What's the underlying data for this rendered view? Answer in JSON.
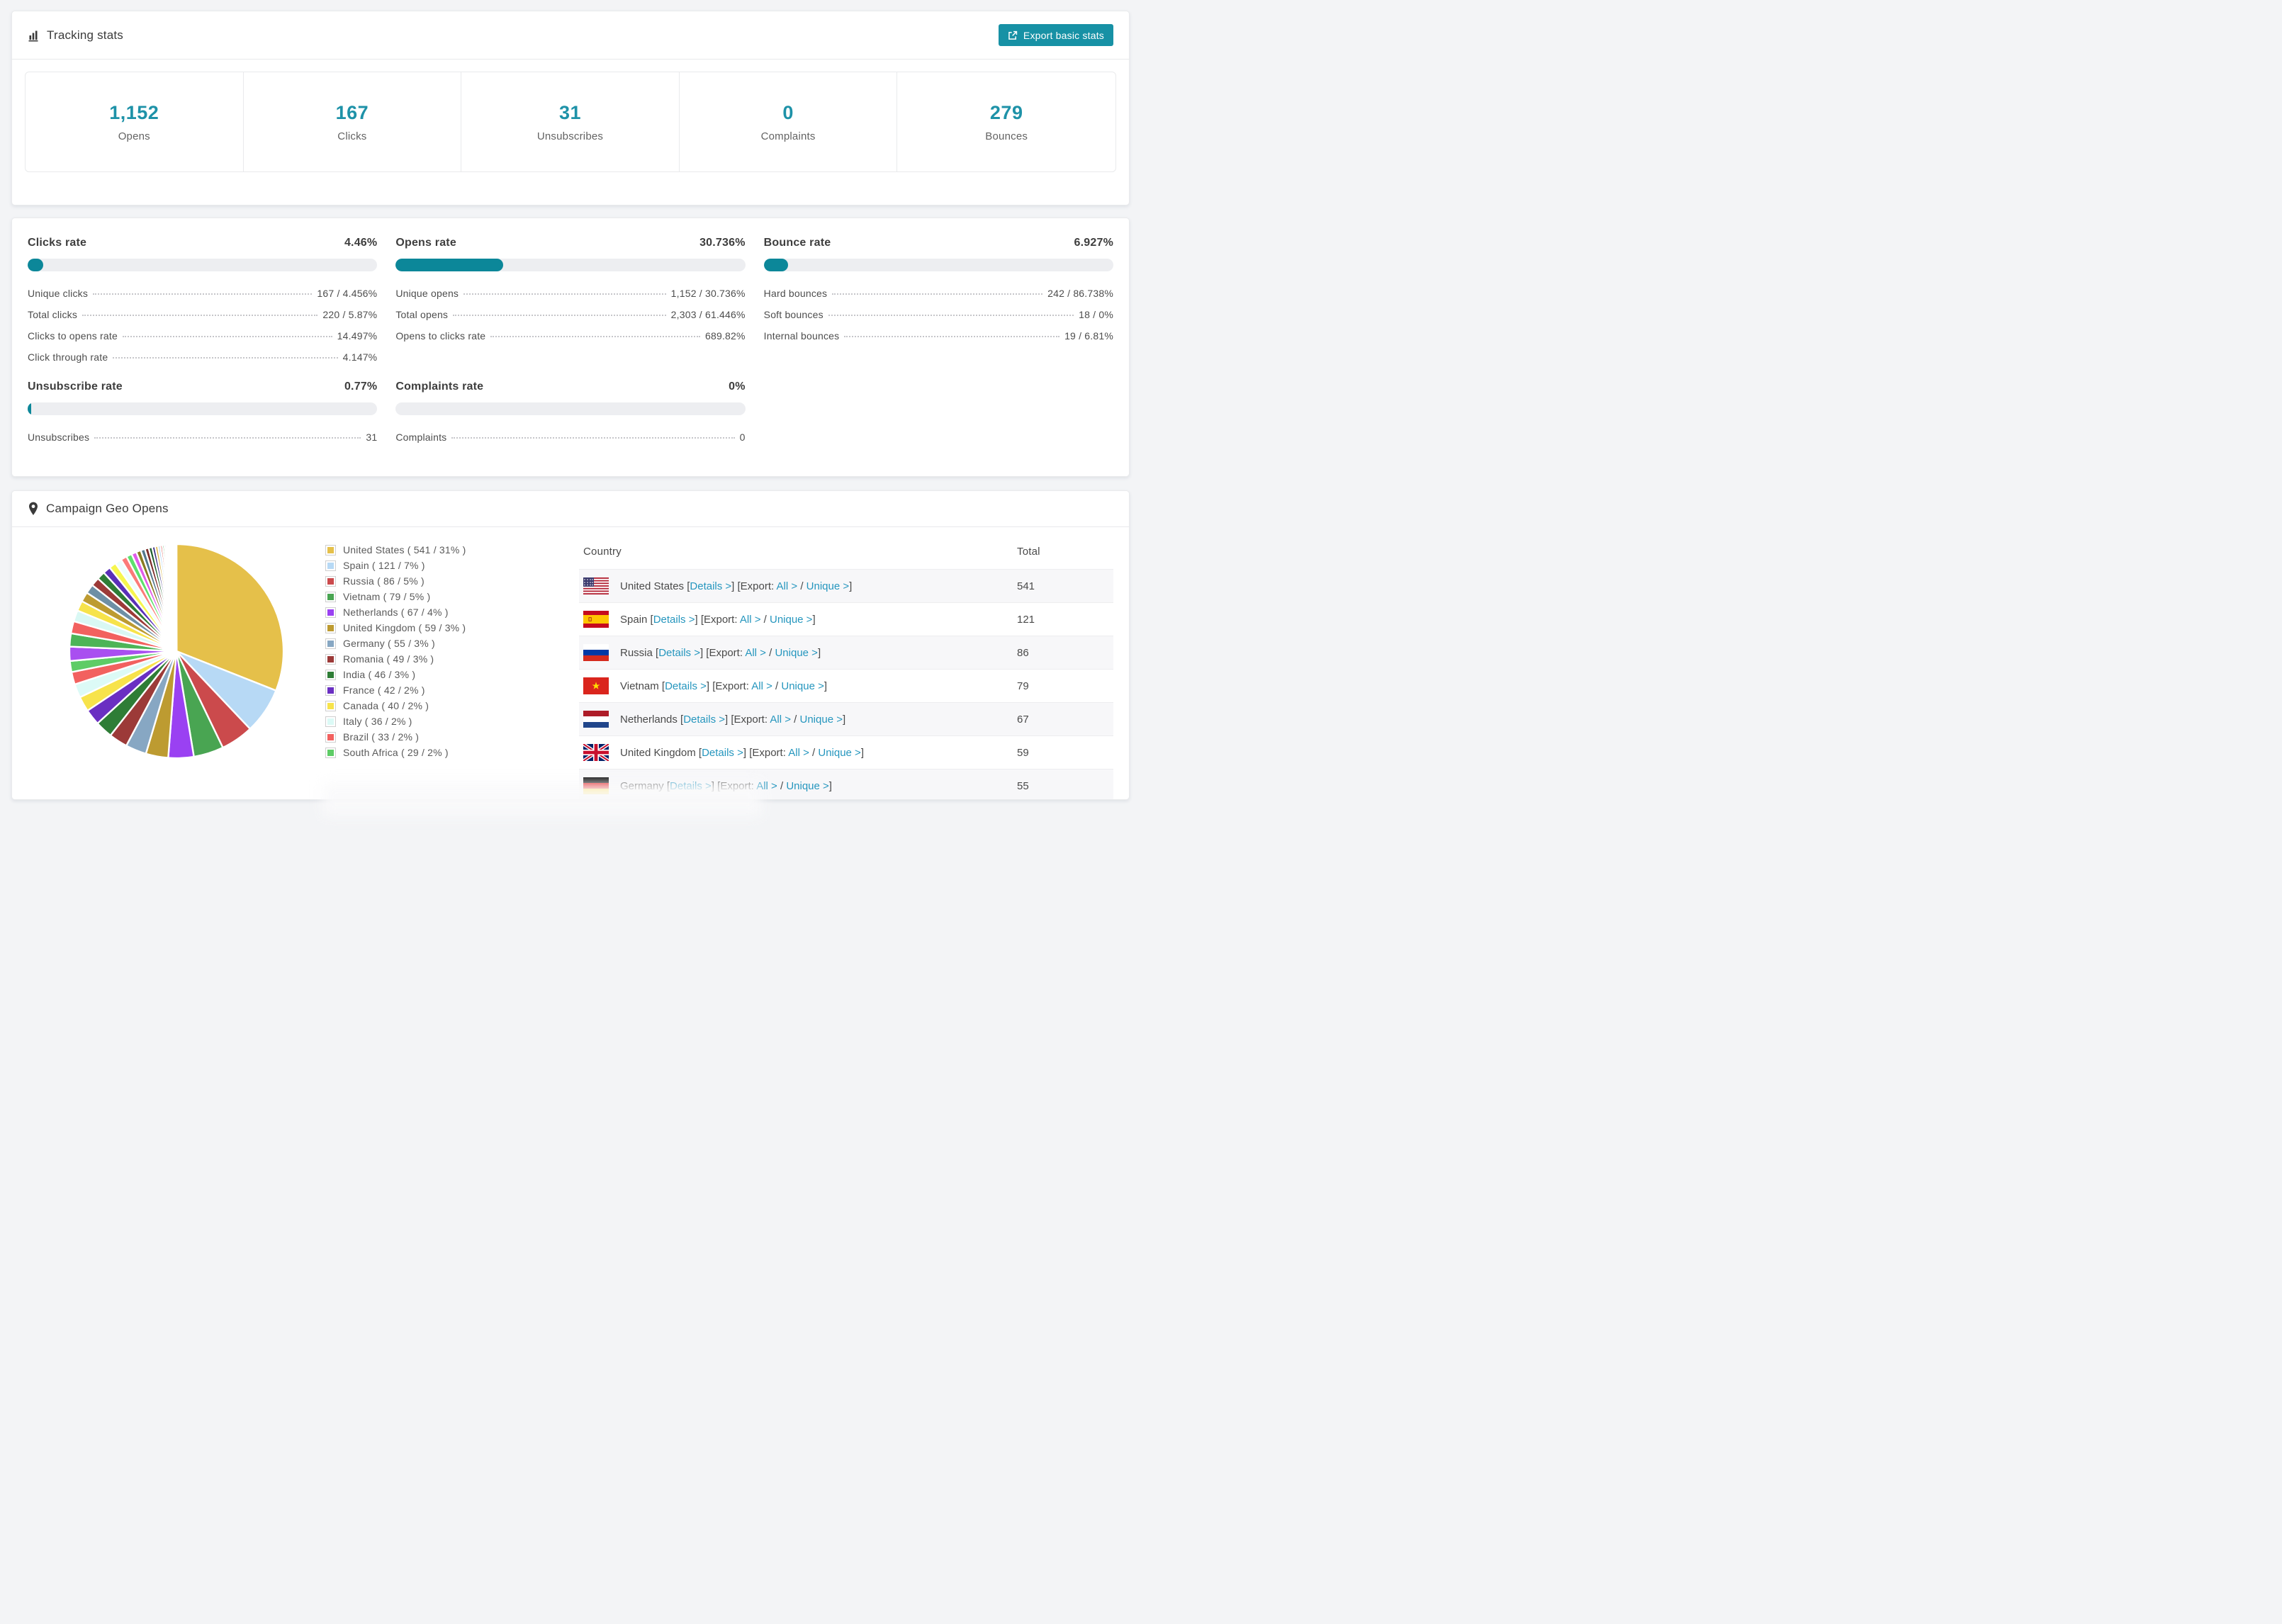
{
  "icons": {
    "tracking_header": "bar-chart-icon",
    "geo_header": "map-pin-icon",
    "export_button": "export-icon"
  },
  "colors": {
    "accent_button": "#1791a5",
    "stat_number": "#1e92a8",
    "bar_fill": "#0c8799",
    "bar_track": "#edeef1",
    "link": "#2596be",
    "row_stripe": "#f7f7f9"
  },
  "tracking": {
    "title": "Tracking stats",
    "export_label": "Export basic stats",
    "summary": [
      {
        "value": "1,152",
        "label": "Opens"
      },
      {
        "value": "167",
        "label": "Clicks"
      },
      {
        "value": "31",
        "label": "Unsubscribes"
      },
      {
        "value": "0",
        "label": "Complaints"
      },
      {
        "value": "279",
        "label": "Bounces"
      }
    ]
  },
  "rates": [
    {
      "id": "clicks-rate",
      "title": "Clicks rate",
      "pct": "4.46%",
      "bar": 4.46,
      "rows": [
        [
          "Unique clicks",
          "167 / 4.456%"
        ],
        [
          "Total clicks",
          "220 / 5.87%"
        ],
        [
          "Clicks to opens rate",
          "14.497%"
        ],
        [
          "Click through rate",
          "4.147%"
        ]
      ]
    },
    {
      "id": "opens-rate",
      "title": "Opens rate",
      "pct": "30.736%",
      "bar": 30.736,
      "rows": [
        [
          "Unique opens",
          "1,152 / 30.736%"
        ],
        [
          "Total opens",
          "2,303 / 61.446%"
        ],
        [
          "Opens to clicks rate",
          "689.82%"
        ]
      ]
    },
    {
      "id": "bounce-rate",
      "title": "Bounce rate",
      "pct": "6.927%",
      "bar": 6.927,
      "rows": [
        [
          "Hard bounces",
          "242 / 86.738%"
        ],
        [
          "Soft bounces",
          "18 / 0%"
        ],
        [
          "Internal bounces",
          "19 / 6.81%"
        ]
      ]
    },
    {
      "id": "unsubscribe-rate",
      "title": "Unsubscribe rate",
      "pct": "0.77%",
      "bar": 0.77,
      "rows": [
        [
          "Unsubscribes",
          "31"
        ]
      ]
    },
    {
      "id": "complaints-rate",
      "title": "Complaints rate",
      "pct": "0%",
      "bar": 0,
      "rows": [
        [
          "Complaints",
          "0"
        ]
      ]
    }
  ],
  "geo": {
    "title": "Campaign Geo Opens",
    "chart_data": {
      "type": "pie",
      "start_angle_deg": -90,
      "direction": "clockwise",
      "legend_position": "right",
      "slices": [
        {
          "label": "United States",
          "value": 541,
          "pct": "31%",
          "color": "#e5c04a"
        },
        {
          "label": "Spain",
          "value": 121,
          "pct": "7%",
          "color": "#b7d9f5"
        },
        {
          "label": "Russia",
          "value": 86,
          "pct": "5%",
          "color": "#cb4a4c"
        },
        {
          "label": "Vietnam",
          "value": 79,
          "pct": "5%",
          "color": "#49a552"
        },
        {
          "label": "Netherlands",
          "value": 67,
          "pct": "4%",
          "color": "#9a41f2"
        },
        {
          "label": "United Kingdom",
          "value": 59,
          "pct": "3%",
          "color": "#bd9b31"
        },
        {
          "label": "Germany",
          "value": 55,
          "pct": "3%",
          "color": "#87a7c3"
        },
        {
          "label": "Romania",
          "value": 49,
          "pct": "3%",
          "color": "#9c3a38"
        },
        {
          "label": "India",
          "value": 46,
          "pct": "3%",
          "color": "#2e7d36"
        },
        {
          "label": "France",
          "value": 42,
          "pct": "2%",
          "color": "#6a2fc2"
        },
        {
          "label": "Canada",
          "value": 40,
          "pct": "2%",
          "color": "#f7e34b"
        },
        {
          "label": "Italy",
          "value": 36,
          "pct": "2%",
          "color": "#dcfaf6"
        },
        {
          "label": "Brazil",
          "value": 33,
          "pct": "2%",
          "color": "#f2615f"
        },
        {
          "label": "South Africa",
          "value": 29,
          "pct": "2%",
          "color": "#5ecc66"
        }
      ],
      "others_total": 462,
      "others_weights": [
        14,
        13,
        12,
        11,
        10,
        9.5,
        9,
        8.5,
        8,
        7.5,
        7,
        6.5,
        6,
        5.5,
        5,
        4.6,
        4.2,
        3.8,
        3.4,
        3,
        2.7,
        2.4,
        2.1,
        1.9,
        1.7,
        1.5,
        1.3,
        1.1,
        1,
        0.9,
        0.8,
        0.7,
        0.6,
        0.5,
        0.42,
        0.35,
        0.28,
        0.22,
        0.17,
        0.12,
        0.08,
        0.05
      ],
      "others_palette": [
        "#a94ff0",
        "#4db457",
        "#f2615f",
        "#d9f8f4",
        "#f7e34b",
        "#bd9b31",
        "#6e8fa5",
        "#9c3a38",
        "#2e7d36",
        "#5a2fb8",
        "#f6f64e",
        "#ecfffd",
        "#fb7b78",
        "#5ee06d",
        "#e05ce9",
        "#8a7a20",
        "#54788c",
        "#7c2d2a",
        "#1f5f2c",
        "#3c2f85",
        "#d6ab32",
        "#a9cef2",
        "#d94a47",
        "#42a44f",
        "#8f3be0"
      ]
    },
    "legend_format": {
      "open": "( ",
      "sep": " / ",
      "close": " )"
    },
    "table": {
      "headers": [
        "Country",
        "Total"
      ],
      "fmt": {
        "lb": "[",
        "rb": "]",
        "details": "Details >",
        "export": "Export:",
        "all": "All >",
        "sep": "/",
        "unique": "Unique >"
      },
      "rows": [
        {
          "country": "United States",
          "flag": "us",
          "total": "541"
        },
        {
          "country": "Spain",
          "flag": "es",
          "total": "121"
        },
        {
          "country": "Russia",
          "flag": "ru",
          "total": "86"
        },
        {
          "country": "Vietnam",
          "flag": "vn",
          "total": "79"
        },
        {
          "country": "Netherlands",
          "flag": "nl",
          "total": "67"
        },
        {
          "country": "United Kingdom",
          "flag": "gb",
          "total": "59"
        },
        {
          "country": "Germany",
          "flag": "de",
          "total": "55"
        }
      ]
    }
  }
}
